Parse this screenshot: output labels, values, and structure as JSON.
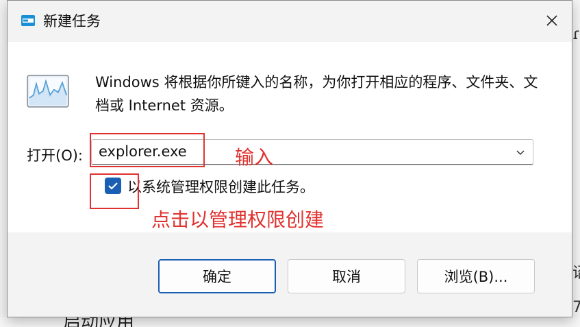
{
  "dialog": {
    "title": "新建任务",
    "description": "Windows 将根据你所键入的名称，为你打开相应的程序、文件夹、文档或 Internet 资源。",
    "open_label": "打开(O):",
    "open_value": "explorer.exe",
    "admin_checkbox_label": "以系统管理权限创建此任务。",
    "admin_checked": true,
    "buttons": {
      "ok": "确定",
      "cancel": "取消",
      "browse": "浏览(B)..."
    }
  },
  "annotations": {
    "input_note": "输入",
    "checkbox_note": "点击以管理权限创建"
  },
  "background": {
    "right_glyphs": [
      "ɾ",
      "诏",
      "7"
    ],
    "bottom_text": "启动应用"
  },
  "colors": {
    "accent": "#1a5fb4",
    "annotation": "#e0322f"
  },
  "icons": {
    "title": "run-app-icon",
    "close": "close-icon",
    "main": "task-manager-run-icon",
    "dropdown": "chevron-down-icon",
    "check": "checkmark-icon"
  }
}
